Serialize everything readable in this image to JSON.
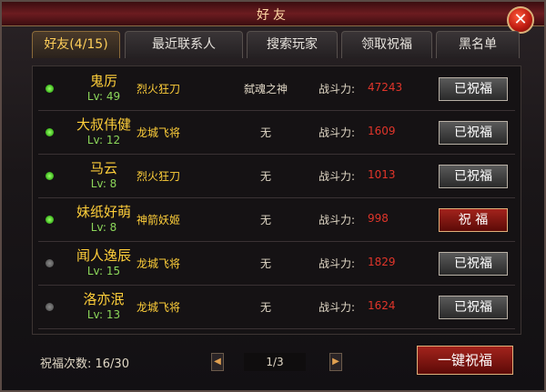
{
  "window": {
    "title": "好友",
    "close_icon": "close-icon"
  },
  "tabs": [
    {
      "label": "好友(4/15)",
      "active": true
    },
    {
      "label": "最近联系人",
      "active": false
    },
    {
      "label": "搜索玩家",
      "active": false
    },
    {
      "label": "领取祝福",
      "active": false
    },
    {
      "label": "黑名单",
      "active": false
    }
  ],
  "friends": [
    {
      "name": "鬼厉",
      "level": "Lv: 49",
      "online": true,
      "profession": "烈火狂刀",
      "title": "弑魂之神",
      "power_label": "战斗力:",
      "power": "47243",
      "button": "已祝福",
      "blessed": true
    },
    {
      "name": "大叔伟健",
      "level": "Lv: 12",
      "online": true,
      "profession": "龙城飞将",
      "title": "无",
      "power_label": "战斗力:",
      "power": "1609",
      "button": "已祝福",
      "blessed": true
    },
    {
      "name": "马云",
      "level": "Lv: 8",
      "online": true,
      "profession": "烈火狂刀",
      "title": "无",
      "power_label": "战斗力:",
      "power": "1013",
      "button": "已祝福",
      "blessed": true
    },
    {
      "name": "妹纸好萌",
      "level": "Lv: 8",
      "online": true,
      "profession": "神箭妖姬",
      "title": "无",
      "power_label": "战斗力:",
      "power": "998",
      "button": "祝 福",
      "blessed": false
    },
    {
      "name": "闻人逸辰",
      "level": "Lv: 15",
      "online": false,
      "profession": "龙城飞将",
      "title": "无",
      "power_label": "战斗力:",
      "power": "1829",
      "button": "已祝福",
      "blessed": true
    },
    {
      "name": "洛亦泯",
      "level": "Lv: 13",
      "online": false,
      "profession": "龙城飞将",
      "title": "无",
      "power_label": "战斗力:",
      "power": "1624",
      "button": "已祝福",
      "blessed": true
    }
  ],
  "footer": {
    "bless_count_label": "祝福次数: 16/30",
    "page": "1/3",
    "prev_icon": "triangle-left-icon",
    "next_icon": "triangle-right-icon",
    "bless_all_label": "一键祝福"
  },
  "colors": {
    "name": "#ffcf3a",
    "level": "#8cd65a",
    "power": "#e0352a",
    "online": "#3cb51c",
    "offline": "#5a5a5a"
  }
}
